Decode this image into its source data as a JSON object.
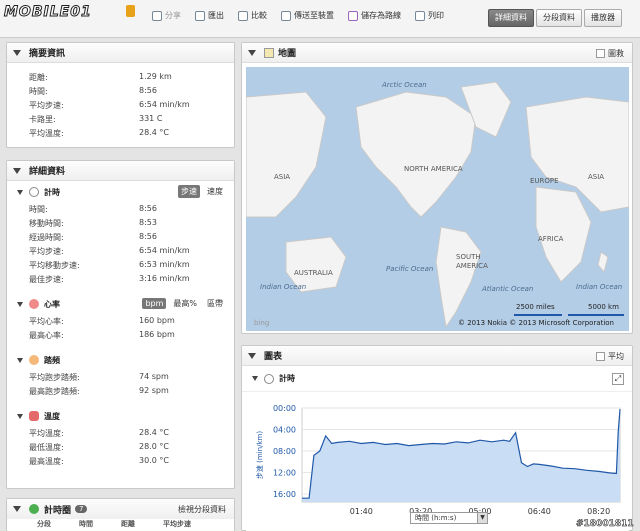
{
  "logo": {
    "text": "MOBILE01",
    "watermark": "#18001811"
  },
  "toolbar": {
    "share": "分享",
    "export": "匯出",
    "compare": "比較",
    "send_device": "傳送至裝置",
    "save_route": "儲存為路線",
    "print": "列印"
  },
  "tabs": [
    "詳細資料",
    "分段資料",
    "播放器"
  ],
  "summary": {
    "title": "摘要資訊",
    "rows": [
      {
        "k": "距離:",
        "v": "1.29 km"
      },
      {
        "k": "時間:",
        "v": "8:56"
      },
      {
        "k": "平均步速:",
        "v": "6:54 min/km"
      },
      {
        "k": "卡路里:",
        "v": "331 C"
      },
      {
        "k": "平均溫度:",
        "v": "28.4 °C"
      }
    ]
  },
  "details": {
    "title": "詳細資料",
    "timing": {
      "title": "計時",
      "opt_on": "步速",
      "opt_off": "速度",
      "rows": [
        {
          "k": "時間:",
          "v": "8:56"
        },
        {
          "k": "移動時間:",
          "v": "8:53"
        },
        {
          "k": "經過時間:",
          "v": "8:56"
        },
        {
          "k": "平均步速:",
          "v": "6:54 min/km"
        },
        {
          "k": "平均移動步速:",
          "v": "6:53 min/km"
        },
        {
          "k": "最佳步速:",
          "v": "3:16 min/km"
        }
      ]
    },
    "heart": {
      "title": "心率",
      "opt_on": "bpm",
      "opt_mid": "最高%",
      "opt_off": "區帶",
      "rows": [
        {
          "k": "平均心率:",
          "v": "160 bpm"
        },
        {
          "k": "最高心率:",
          "v": "186 bpm"
        }
      ]
    },
    "cadence": {
      "title": "踏頻",
      "rows": [
        {
          "k": "平均跑步踏頻:",
          "v": "74 spm"
        },
        {
          "k": "最高跑步踏頻:",
          "v": "92 spm"
        }
      ]
    },
    "temp": {
      "title": "溫度",
      "rows": [
        {
          "k": "平均溫度:",
          "v": "28.4 °C"
        },
        {
          "k": "最低溫度:",
          "v": "28.0 °C"
        },
        {
          "k": "最高溫度:",
          "v": "30.0 °C"
        }
      ]
    }
  },
  "laps": {
    "title": "計時圈",
    "count": "7",
    "link": "檢視分段資料",
    "cols": [
      "分段",
      "時間",
      "距離",
      "平均步速"
    ]
  },
  "map": {
    "title": "地圖",
    "legend_label": "圖救",
    "labels": {
      "arctic": "Arctic Ocean",
      "asia1": "ASIA",
      "north_america": "NORTH AMERICA",
      "europe": "EUROPE",
      "asia2": "ASIA",
      "africa": "AFRICA",
      "australia": "AUSTRALIA",
      "pacific": "Pacific Ocean",
      "south_america": "SOUTH AMERICA",
      "indian1": "Indian Ocean",
      "atlantic": "Atlantic Ocean",
      "indian2": "Indian Ocean"
    },
    "scale_miles": "2500 miles",
    "scale_km": "5000 km",
    "copyright": "© 2013 Nokia   © 2013 Microsoft Corporation",
    "bing": "bing"
  },
  "charts": {
    "title": "圖表",
    "avg_label": "平均",
    "sub_title": "計時",
    "x_select": "時間 (h:m:s)"
  },
  "colors": {
    "accent": "#1f58a8",
    "fill": "#c9ddf5",
    "line": "#1f58a8"
  },
  "chart_data": {
    "type": "area",
    "title": "",
    "xlabel": "時間 (h:m:s)",
    "ylabel": "步速 (min/km)",
    "x_ticks": [
      "01:40",
      "03:20",
      "05:00",
      "06:40",
      "08:20"
    ],
    "y_ticks": [
      "00:00",
      "04:00",
      "08:00",
      "12:00",
      "16:00"
    ],
    "x_range_sec": [
      0,
      536
    ],
    "y_range_min": [
      0,
      17.5
    ],
    "y_inverted": true,
    "x_sec": [
      0,
      12,
      20,
      30,
      40,
      50,
      60,
      80,
      100,
      120,
      140,
      160,
      180,
      200,
      220,
      240,
      260,
      280,
      300,
      320,
      340,
      350,
      360,
      370,
      380,
      390,
      400,
      420,
      440,
      460,
      480,
      500,
      520,
      530,
      533,
      536
    ],
    "pace_min": [
      16.8,
      16.8,
      8.8,
      8.0,
      5.2,
      6.6,
      6.4,
      6.2,
      6.6,
      6.4,
      6.8,
      6.6,
      7.0,
      6.8,
      6.6,
      6.7,
      6.3,
      6.5,
      6.0,
      6.3,
      6.0,
      6.2,
      4.6,
      10.2,
      10.9,
      10.4,
      10.5,
      10.8,
      11.2,
      11.3,
      11.6,
      11.8,
      12.1,
      12.2,
      4.5,
      0.2
    ]
  }
}
